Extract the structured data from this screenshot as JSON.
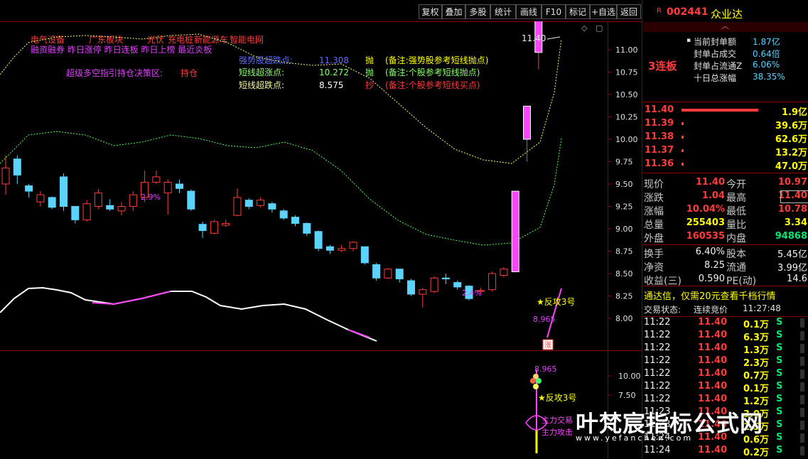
{
  "toolbar": {
    "buttons": [
      "复权",
      "叠加",
      "多股",
      "统计",
      "画线",
      "F10",
      "标记",
      "+自选",
      "返回"
    ]
  },
  "header": {
    "tags_line1": [
      "电气设备",
      "广东板块",
      "光伏",
      "充电桩",
      "新能源车",
      "智能电网"
    ],
    "tags_line2": "融资融券 昨日涨停 昨日连板 昨日上榜 最近炎板",
    "decision_label": "超级多空指引持仓决策区:",
    "decision_value": "持仓",
    "signals": [
      {
        "label": "强势股超跌点:",
        "value": "11.308",
        "action": "抛",
        "note": "(备注:强势股参考短线抛点)"
      },
      {
        "label": "短线超涨点:",
        "value": "10.272",
        "action": "抛",
        "note": "(备注:个股参考短线抛点)"
      },
      {
        "label": "短线超跌点:",
        "value": "8.575",
        "action": "抄",
        "note": "(备注:个股参考短线买点)"
      }
    ]
  },
  "main_chart": {
    "y_ticks": [
      "11.00",
      "10.75",
      "10.50",
      "10.25",
      "10.00",
      "9.75",
      "9.50",
      "9.25",
      "9.00",
      "8.75",
      "8.50",
      "8.25",
      "8.00"
    ],
    "annotations": {
      "high_label": "11.40",
      "pct_left": "2.9%",
      "pct_right": "2.4%",
      "fangong": "★反攻3号",
      "value_8965": "8.965",
      "zhang": "涨"
    }
  },
  "sub_chart": {
    "y_ticks": [
      "10.00",
      "7.50"
    ],
    "labels": {
      "value": "8.965",
      "fangong": "★反攻3号",
      "trade1": "主力交易",
      "trade2": "主力攻击"
    }
  },
  "panel": {
    "code": "002441",
    "name": "众业达",
    "board": "3连板",
    "seal_stats": [
      {
        "label": "当前封单额",
        "value": "1.87亿"
      },
      {
        "label": "封单占成交",
        "value": "0.64倍"
      },
      {
        "label": "封单占流通Z",
        "value": "6.06%"
      },
      {
        "label": "十日总涨幅",
        "value": "38.35%"
      }
    ],
    "order_book": [
      {
        "price": "11.40",
        "vol": "1.9亿",
        "bar": 1.0
      },
      {
        "price": "11.39",
        "vol": "39.6万",
        "bar": 0.02
      },
      {
        "price": "11.38",
        "vol": "62.6万",
        "bar": 0.02
      },
      {
        "price": "11.37",
        "vol": "13.2万",
        "bar": 0.02
      },
      {
        "price": "11.36",
        "vol": "47.0万",
        "bar": 0.02
      }
    ],
    "quote": [
      {
        "l1": "现价",
        "v1": "11.40",
        "c1": "red",
        "l2": "今开",
        "v2": "10.97",
        "c2": "red"
      },
      {
        "l1": "涨跌",
        "v1": "1.04",
        "c1": "red",
        "l2": "最高",
        "v2": "11.40",
        "c2": "red"
      },
      {
        "l1": "涨幅",
        "v1": "10.04%",
        "c1": "red",
        "l2": "最低",
        "v2": "10.78",
        "c2": "red"
      },
      {
        "l1": "总量",
        "v1": "255403",
        "c1": "yel",
        "l2": "量比",
        "v2": "3.34",
        "c2": "yel"
      },
      {
        "l1": "外盘",
        "v1": "160535",
        "c1": "red",
        "l2": "内盘",
        "v2": "94868",
        "c2": "grn"
      }
    ],
    "fund": [
      {
        "l1": "换手",
        "v1": "6.40%",
        "l2": "股本",
        "v2": "5.45亿"
      },
      {
        "l1": "净资",
        "v1": "8.25",
        "l2": "流通",
        "v2": "3.99亿"
      },
      {
        "l1": "收益(三)",
        "v1": "0.590",
        "l2": "PE(动)",
        "v2": "14.6"
      }
    ],
    "ad_text": "通达信，仅需20元查看千档行情",
    "trade_state_label": "交易状态:",
    "trade_state_value": "连续竞价",
    "trade_state_time": "11:27:48",
    "ticks": [
      {
        "time": "11:22",
        "price": "11.40",
        "vol": "0.1万",
        "side": "S"
      },
      {
        "time": "11:22",
        "price": "11.40",
        "vol": "6.3万",
        "side": "S"
      },
      {
        "time": "11:22",
        "price": "11.40",
        "vol": "1.3万",
        "side": "S"
      },
      {
        "time": "11:22",
        "price": "11.40",
        "vol": "2.3万",
        "side": "S"
      },
      {
        "time": "11:22",
        "price": "11.40",
        "vol": "0.7万",
        "side": "S"
      },
      {
        "time": "11:22",
        "price": "11.40",
        "vol": "0.1万",
        "side": "S"
      },
      {
        "time": "11:22",
        "price": "11.40",
        "vol": "1.2万",
        "side": "S"
      },
      {
        "time": "11:23",
        "price": "11.40",
        "vol": "3.0万",
        "side": "S"
      },
      {
        "time": "11:23",
        "price": "11.40",
        "vol": "1.5万",
        "side": "S"
      },
      {
        "time": "11:24",
        "price": "11.40",
        "vol": "0.6万",
        "side": "S"
      },
      {
        "time": "11:24",
        "price": "11.40",
        "vol": "0.2万",
        "side": "S"
      }
    ]
  },
  "watermark": {
    "title": "叶梵宸指标公式网",
    "url": "www.yefanchen.com"
  },
  "candles": [
    {
      "o": 9.5,
      "c": 9.68,
      "h": 9.82,
      "l": 9.38
    },
    {
      "o": 9.78,
      "c": 9.6,
      "h": 9.82,
      "l": 9.5
    },
    {
      "o": 9.48,
      "c": 9.42,
      "h": 9.5,
      "l": 9.35
    },
    {
      "o": 9.3,
      "c": 9.38,
      "h": 9.42,
      "l": 9.25
    },
    {
      "o": 9.35,
      "c": 9.24,
      "h": 9.36,
      "l": 9.22
    },
    {
      "o": 9.58,
      "c": 9.25,
      "h": 9.62,
      "l": 9.2
    },
    {
      "o": 9.25,
      "c": 9.1,
      "h": 9.25,
      "l": 9.06
    },
    {
      "o": 9.1,
      "c": 9.28,
      "h": 9.32,
      "l": 9.08
    },
    {
      "o": 9.25,
      "c": 9.4,
      "h": 9.44,
      "l": 9.22
    },
    {
      "o": 9.26,
      "c": 9.22,
      "h": 9.33,
      "l": 9.2
    },
    {
      "o": 9.2,
      "c": 9.25,
      "h": 9.3,
      "l": 9.15
    },
    {
      "o": 9.25,
      "c": 9.38,
      "h": 9.42,
      "l": 9.2
    },
    {
      "o": 9.35,
      "c": 9.52,
      "h": 9.65,
      "l": 9.3
    },
    {
      "o": 9.52,
      "c": 9.58,
      "h": 9.65,
      "l": 9.5
    },
    {
      "o": 9.4,
      "c": 9.52,
      "h": 9.55,
      "l": 9.16
    },
    {
      "o": 9.5,
      "c": 9.45,
      "h": 9.55,
      "l": 9.4
    },
    {
      "o": 9.42,
      "c": 9.22,
      "h": 9.44,
      "l": 9.2
    },
    {
      "o": 9.05,
      "c": 8.98,
      "h": 9.08,
      "l": 8.9
    },
    {
      "o": 8.95,
      "c": 9.08,
      "h": 9.1,
      "l": 8.94
    },
    {
      "o": 9.04,
      "c": 9.06,
      "h": 9.1,
      "l": 9.02
    },
    {
      "o": 9.15,
      "c": 9.35,
      "h": 9.45,
      "l": 9.14
    },
    {
      "o": 9.32,
      "c": 9.25,
      "h": 9.34,
      "l": 9.22
    },
    {
      "o": 9.26,
      "c": 9.32,
      "h": 9.35,
      "l": 9.24
    },
    {
      "o": 9.28,
      "c": 9.22,
      "h": 9.3,
      "l": 9.18
    },
    {
      "o": 9.2,
      "c": 9.12,
      "h": 9.22,
      "l": 9.1
    },
    {
      "o": 9.13,
      "c": 9.06,
      "h": 9.15,
      "l": 9.03
    },
    {
      "o": 9.06,
      "c": 8.95,
      "h": 9.07,
      "l": 8.92
    },
    {
      "o": 8.97,
      "c": 8.78,
      "h": 8.98,
      "l": 8.75
    },
    {
      "o": 8.8,
      "c": 8.76,
      "h": 8.82,
      "l": 8.72
    },
    {
      "o": 8.76,
      "c": 8.78,
      "h": 8.82,
      "l": 8.74
    },
    {
      "o": 8.78,
      "c": 8.85,
      "h": 8.86,
      "l": 8.75
    },
    {
      "o": 8.8,
      "c": 8.62,
      "h": 8.8,
      "l": 8.6
    },
    {
      "o": 8.6,
      "c": 8.45,
      "h": 8.62,
      "l": 8.42
    },
    {
      "o": 8.45,
      "c": 8.55,
      "h": 8.56,
      "l": 8.44
    },
    {
      "o": 8.55,
      "c": 8.44,
      "h": 8.55,
      "l": 8.4
    },
    {
      "o": 8.42,
      "c": 8.27,
      "h": 8.44,
      "l": 8.25
    },
    {
      "o": 8.27,
      "c": 8.32,
      "h": 8.34,
      "l": 8.12
    },
    {
      "o": 8.3,
      "c": 8.45,
      "h": 8.47,
      "l": 8.28
    },
    {
      "o": 8.45,
      "c": 8.44,
      "h": 8.5,
      "l": 8.38
    },
    {
      "o": 8.4,
      "c": 8.35,
      "h": 8.42,
      "l": 8.32
    },
    {
      "o": 8.36,
      "c": 8.22,
      "h": 8.37,
      "l": 8.2
    },
    {
      "o": 8.3,
      "c": 8.31,
      "h": 8.34,
      "l": 8.28
    },
    {
      "o": 8.32,
      "c": 8.5,
      "h": 8.52,
      "l": 8.3
    },
    {
      "o": 8.48,
      "c": 8.55,
      "h": 8.57,
      "l": 8.46
    },
    {
      "o": 8.52,
      "c": 9.42,
      "h": 9.42,
      "l": 8.52
    },
    {
      "o": 10.0,
      "c": 10.37,
      "h": 10.37,
      "l": 9.75
    },
    {
      "o": 10.97,
      "c": 11.4,
      "h": 11.4,
      "l": 10.78
    }
  ]
}
